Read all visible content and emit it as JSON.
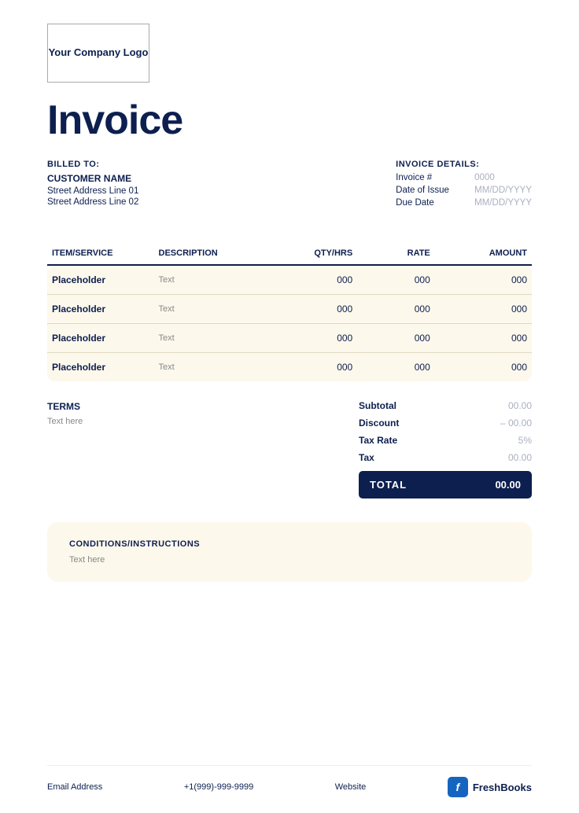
{
  "logo": {
    "text": "Your Company Logo"
  },
  "title": "Invoice",
  "billed_to": {
    "label": "BILLED TO:",
    "customer_name": "CUSTOMER NAME",
    "address_line1": "Street Address Line 01",
    "address_line2": "Street Address Line 02"
  },
  "invoice_details": {
    "label": "INVOICE DETAILS:",
    "fields": [
      {
        "label": "Invoice #",
        "value": "0000"
      },
      {
        "label": "Date of Issue",
        "value": "MM/DD/YYYY"
      },
      {
        "label": "Due Date",
        "value": "MM/DD/YYYY"
      }
    ]
  },
  "table": {
    "headers": [
      "ITEM/SERVICE",
      "DESCRIPTION",
      "QTY/HRS",
      "RATE",
      "AMOUNT"
    ],
    "rows": [
      {
        "item": "Placeholder",
        "description": "Text",
        "qty": "000",
        "rate": "000",
        "amount": "000"
      },
      {
        "item": "Placeholder",
        "description": "Text",
        "qty": "000",
        "rate": "000",
        "amount": "000"
      },
      {
        "item": "Placeholder",
        "description": "Text",
        "qty": "000",
        "rate": "000",
        "amount": "000"
      },
      {
        "item": "Placeholder",
        "description": "Text",
        "qty": "000",
        "rate": "000",
        "amount": "000"
      }
    ]
  },
  "terms": {
    "title": "TERMS",
    "text": "Text here"
  },
  "totals": {
    "subtotal_label": "Subtotal",
    "subtotal_value": "00.00",
    "discount_label": "Discount",
    "discount_value": "– 00.00",
    "tax_rate_label": "Tax Rate",
    "tax_rate_value": "5%",
    "tax_label": "Tax",
    "tax_value": "00.00",
    "total_label": "TOTAL",
    "total_value": "00.00"
  },
  "conditions": {
    "title": "CONDITIONS/INSTRUCTIONS",
    "text": "Text here"
  },
  "footer": {
    "email": "Email Address",
    "phone": "+1(999)-999-9999",
    "website": "Website",
    "brand": "FreshBooks",
    "brand_icon": "f"
  }
}
